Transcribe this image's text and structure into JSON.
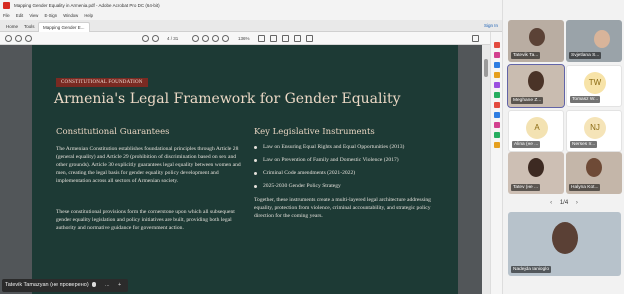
{
  "window": {
    "title": "Mapping Gender Equality in Armenia.pdf - Adobe Acrobat Pro DC (64-bit)",
    "menu": [
      "File",
      "Edit",
      "View",
      "E-Sign",
      "Window",
      "Help"
    ]
  },
  "tabs": {
    "home": "Home",
    "tools": "Tools",
    "document": "Mapping Gender E...",
    "sign_in": "Sign In"
  },
  "toolbar": {
    "page_current": "4",
    "page_total": "/ 31",
    "zoom": "136%"
  },
  "slide": {
    "badge": "CONSTITUTIONAL FOUNDATION",
    "title": "Armenia's Legal Framework for Gender Equality",
    "left_heading": "Constitutional Guarantees",
    "left_p1": "The Armenian Constitution establishes foundational principles through Article 28 (general equality) and Article 29 (prohibition of discrimination based on sex and other grounds). Article 30 explicitly guarantees legal equality between women and men, creating the legal basis for gender equality policy development and implementation across all sectors of Armenian society.",
    "left_p2": "These constitutional provisions form the cornerstone upon which all subsequent gender equality legislation and policy initiatives are built, providing both legal authority and normative guidance for government action.",
    "right_heading": "Key Legislative Instruments",
    "bullets": [
      "Law on Ensuring Equal Rights and Equal Opportunities (2013)",
      "Law on Prevention of Family and Domestic Violence (2017)",
      "Criminal Code amendments (2021-2022)",
      "2025-2030 Gender Policy Strategy"
    ],
    "right_p": "Together, these instruments create a multi-layered legal architecture addressing equality, protection from violence, criminal accountability, and strategic policy direction for the coming years."
  },
  "caption": {
    "name": "Tatevik Tamazyan (не проверено)",
    "more": "...",
    "add": "+"
  },
  "participants": [
    {
      "name": "Tatevik Ta...",
      "kind": "video"
    },
    {
      "name": "Svjetlana S...",
      "kind": "video"
    },
    {
      "name": "Meghane Z...",
      "kind": "video"
    },
    {
      "name": "Tomasz W...",
      "kind": "avatar",
      "initials": "TW",
      "color": "#f7e3a8",
      "text_color": "#8a6a12"
    },
    {
      "name": "Alina (не ...",
      "kind": "avatar",
      "initials": "A",
      "color": "#f3e2b2",
      "text_color": "#8a6a12"
    },
    {
      "name": "Nerses Ir...",
      "kind": "avatar",
      "initials": "NJ",
      "color": "#f5e4b8",
      "text_color": "#8a6a12"
    },
    {
      "name": "Tatev (не ...",
      "kind": "video"
    },
    {
      "name": "Halyna Kot...",
      "kind": "video"
    }
  ],
  "pager": {
    "label": "1/4",
    "prev": "‹",
    "next": "›"
  },
  "self_view": {
    "name": "Nadejda Ianioglo"
  }
}
